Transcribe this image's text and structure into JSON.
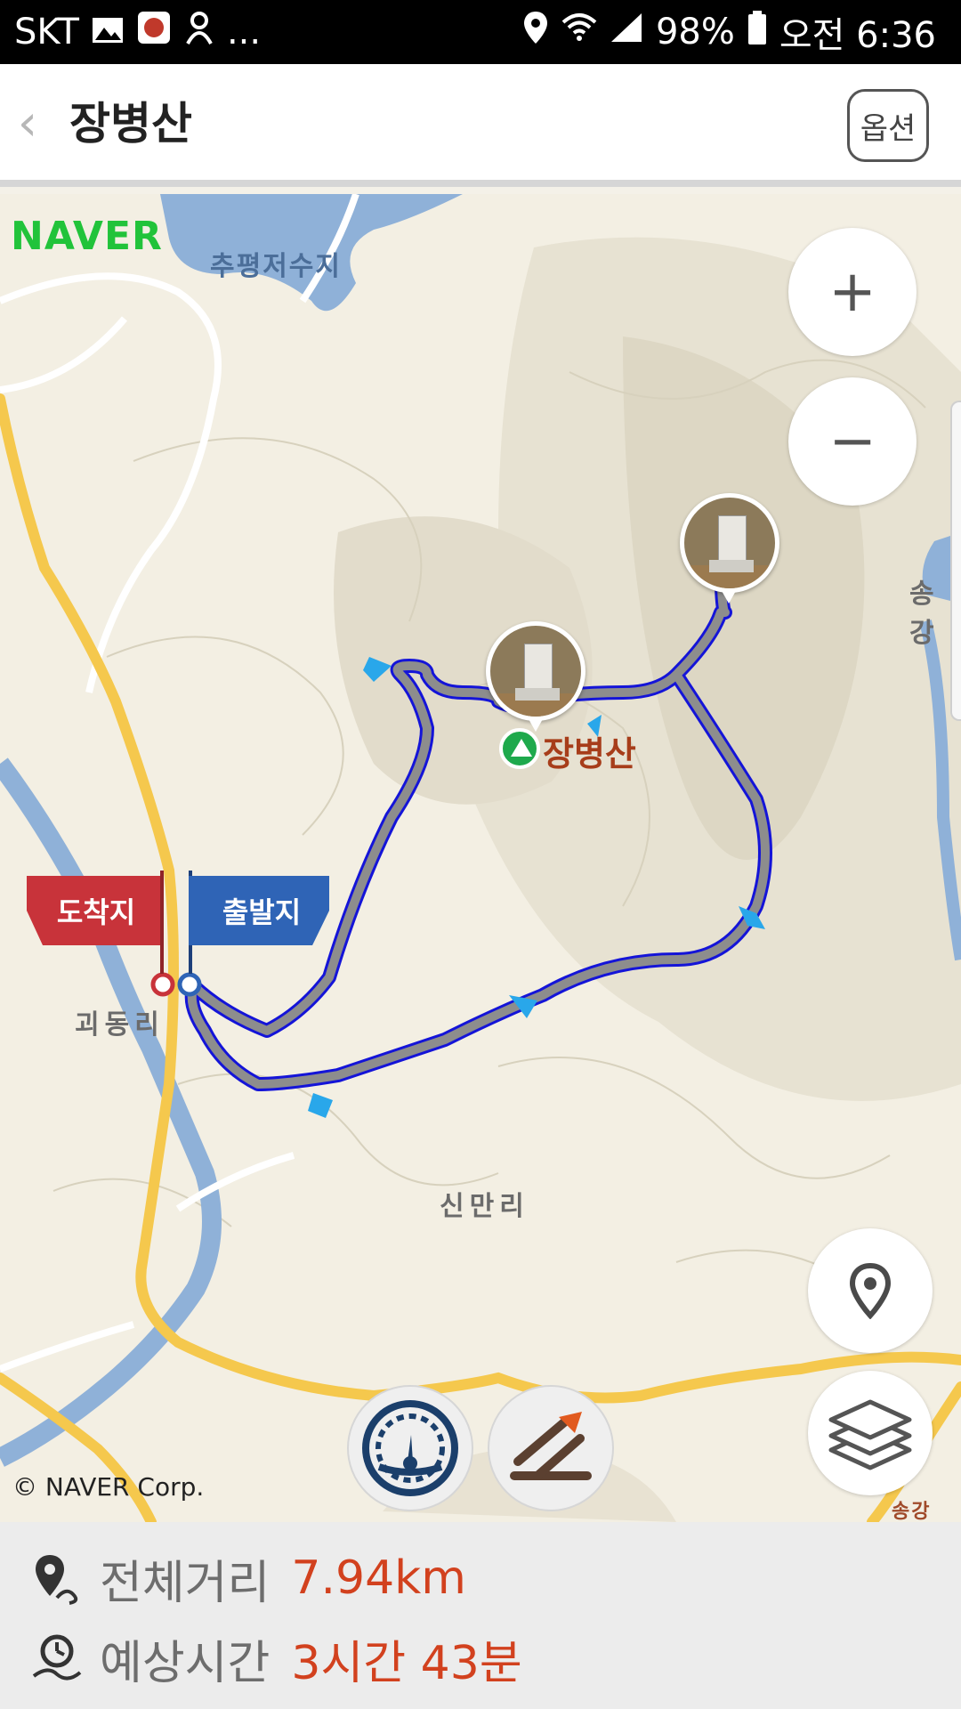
{
  "status_bar": {
    "carrier": "SKT",
    "more": "...",
    "battery": "98%",
    "time": "오전 6:36"
  },
  "header": {
    "back_icon": "chevron-left-icon",
    "title": "장병산",
    "option_label": "옵션"
  },
  "map": {
    "logo": "NAVER",
    "labels": {
      "reservoir": "추평저수지",
      "village_a": "괴동리",
      "village_b": "신만리",
      "edge_right": "송강",
      "edge_bottom": "송강"
    },
    "summit_name": "장병산",
    "flags": {
      "arrival": "도착지",
      "departure": "출발지"
    },
    "zoom_in": "+",
    "zoom_out": "−",
    "copyright": "© NAVER Corp."
  },
  "route_info": {
    "distance_label": "전체거리",
    "distance_value": "7.94km",
    "time_label": "예상시간",
    "time_value": "3시간 43분"
  },
  "colors": {
    "route_line": "#8d8d8d",
    "route_outline": "#1414d8",
    "accent_value": "#d2411e",
    "naver_green": "#21c33a",
    "road_yellow": "#f5c84d",
    "river_blue": "#8fb1d8"
  }
}
